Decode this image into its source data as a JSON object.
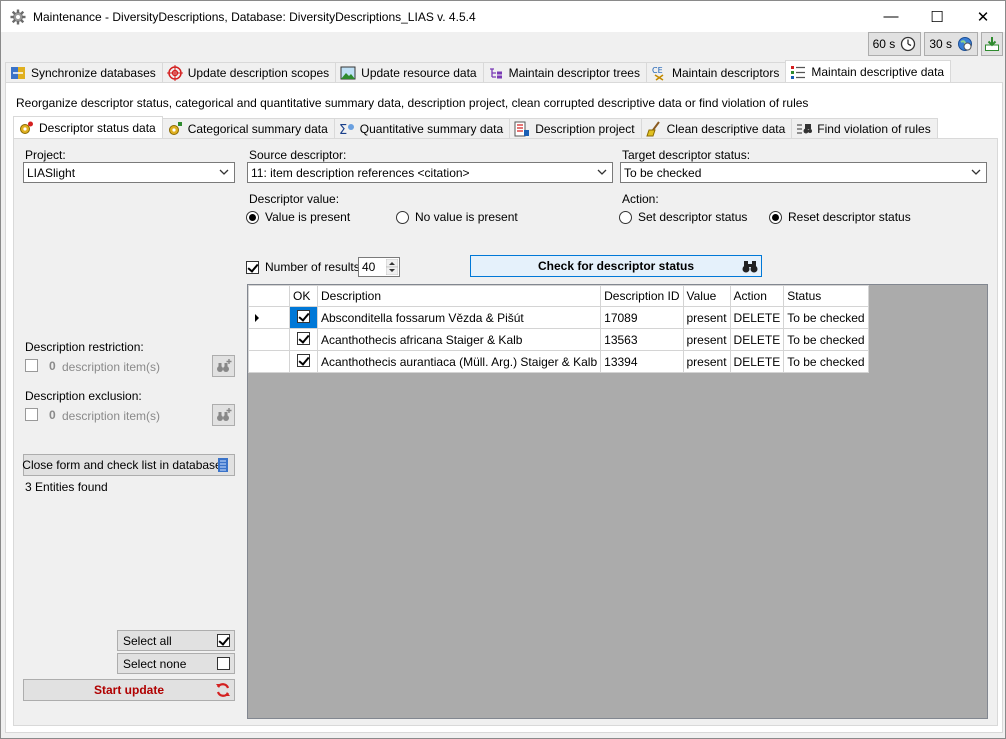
{
  "window": {
    "title": "Maintenance - DiversityDescriptions,  Database: DiversityDescriptions_LIAS    v. 4.5.4",
    "minimize": "—",
    "maximize": "☐",
    "close": "✕"
  },
  "toolbar": {
    "timer1": "60 s",
    "timer2": "30 s"
  },
  "main_tabs": [
    {
      "label": "Synchronize databases"
    },
    {
      "label": "Update description scopes"
    },
    {
      "label": "Update resource data"
    },
    {
      "label": "Maintain descriptor trees"
    },
    {
      "label": "Maintain descriptors"
    },
    {
      "label": "Maintain descriptive data"
    }
  ],
  "description_text": "Reorganize descriptor status, categorical and quantitative summary data, description project, clean corrupted descriptive data or find violation of rules",
  "sub_tabs": [
    {
      "label": "Descriptor status data"
    },
    {
      "label": "Categorical summary data"
    },
    {
      "label": "Quantitative summary data"
    },
    {
      "label": "Description project"
    },
    {
      "label": "Clean descriptive data"
    },
    {
      "label": "Find violation of rules"
    }
  ],
  "form": {
    "project_label": "Project:",
    "project_value": "LIASlight",
    "source_label": "Source descriptor:",
    "source_value": "11: item description references <citation>",
    "target_label": "Target descriptor status:",
    "target_value": "To be checked",
    "descriptor_value_label": "Descriptor value:",
    "value_present": "Value is present",
    "value_absent": "No value is present",
    "action_label": "Action:",
    "action_set": "Set descriptor status",
    "action_reset": "Reset descriptor status",
    "num_results_label": "Number of results:",
    "num_results_value": "40",
    "check_button": "Check for descriptor status"
  },
  "left": {
    "restriction_label": "Description restriction:",
    "restriction_count": "0",
    "restriction_items": "description item(s)",
    "exclusion_label": "Description exclusion:",
    "exclusion_count": "0",
    "exclusion_items": "description item(s)",
    "close_button": "Close form and check list in database",
    "entities_found": "3 Entities found",
    "select_all": "Select all",
    "select_none": "Select none",
    "start_update": "Start update"
  },
  "table": {
    "headers": [
      "OK",
      "Description",
      "Description ID",
      "Value",
      "Action",
      "Status"
    ],
    "rows": [
      {
        "description": "Absconditella fossarum Vězda & Pišút",
        "id": "17089",
        "value": "present",
        "action": "DELETE",
        "status": "To be checked"
      },
      {
        "description": "Acanthothecis africana Staiger & Kalb",
        "id": "13563",
        "value": "present",
        "action": "DELETE",
        "status": "To be checked"
      },
      {
        "description": "Acanthothecis aurantiaca (Müll. Arg.) Staiger & Kalb",
        "id": "13394",
        "value": "present",
        "action": "DELETE",
        "status": "To be checked"
      }
    ]
  }
}
